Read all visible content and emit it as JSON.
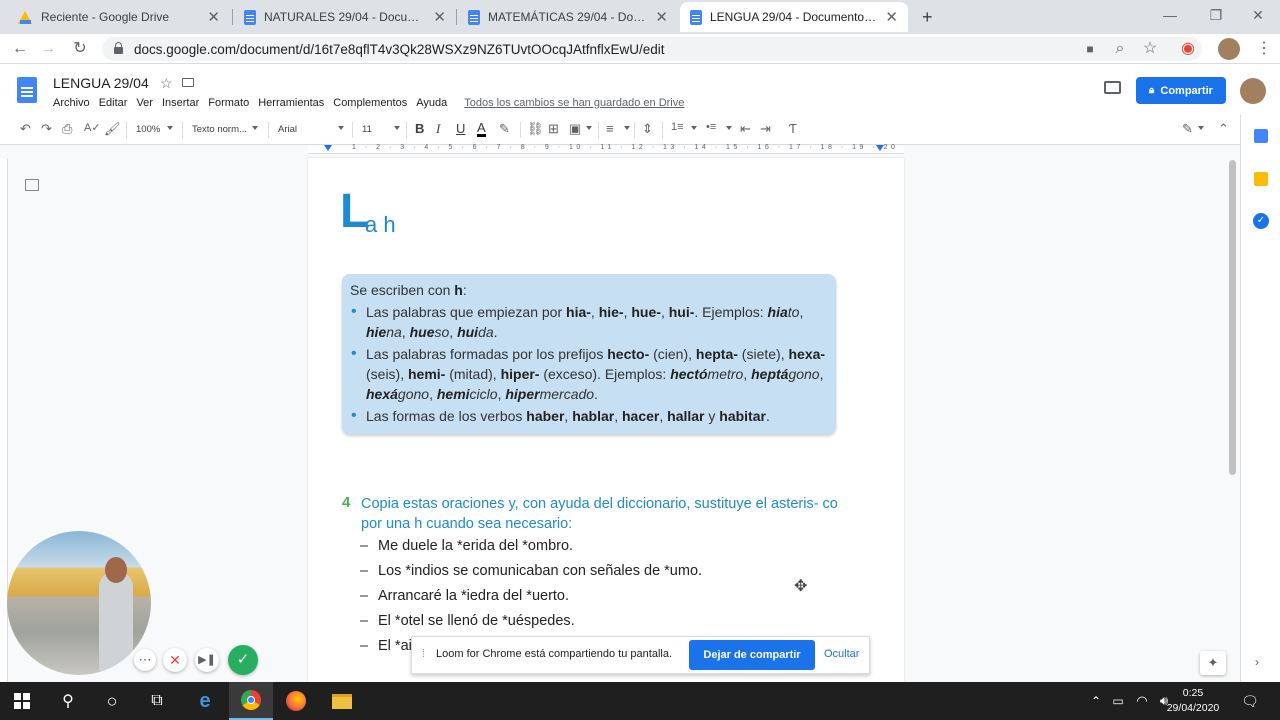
{
  "tabs": [
    {
      "title": "Reciente - Google Drive",
      "icon": "drive-icon"
    },
    {
      "title": "NATURALES 29/04 - Documentos de Google",
      "icon": "docs-icon"
    },
    {
      "title": "MATEMÁTICAS 29/04 - Documentos de Google",
      "icon": "docs-icon"
    },
    {
      "title": "LENGUA 29/04 - Documentos de Google",
      "icon": "docs-icon"
    }
  ],
  "address": {
    "url": "docs.google.com/document/d/16t7e8qflT4v3Qk28WSXz9NZ6TUvtOOcqJAtfnflxEwU/edit"
  },
  "docs": {
    "title": "LENGUA 29/04",
    "menu": [
      "Archivo",
      "Editar",
      "Ver",
      "Insertar",
      "Formato",
      "Herramientas",
      "Complementos",
      "Ayuda"
    ],
    "save_status": "Todos los cambios se han guardado en Drive",
    "share_label": "Compartir"
  },
  "toolbar": {
    "zoom": "100%",
    "style": "Texto norm...",
    "font": "Arial",
    "size": "11"
  },
  "ruler": {
    "numbers": "1 · 2 · 3 · 4 · 5 · 6 · 7 · 8 · 9 · 10 · 11 · 12 · 13 · 14 · 15 · 16 · 17 · 18 · 19 · 20"
  },
  "page": {
    "heading_big": "L",
    "heading_rest": "a h",
    "rule": {
      "intro_a": "Se escriben con ",
      "intro_b": "h",
      ", ": "",
      "item1": "Las palabras que empiezan por hia-, hie-, hue-, hui-. Ejemplos: hiato, hiena, hueso, huida.",
      "item2": "Las palabras formadas por los prefijos hecto- (cien), hepta- (siete), hexa- (seis), hemi- (mitad), hiper- (exceso). Ejemplos: hectómetro, heptágono, hexágono, hemiciclo, hipermercado.",
      "item3": "Las formas de los verbos haber, hablar, hacer, hallar y habitar."
    },
    "exercise": {
      "number": "4",
      "instruction": "Copia estas oraciones y, con ayuda del diccionario, sustituye el asteris- co por una h cuando sea necesario:",
      "dash": "–",
      "sentences": [
        "Me duele la *erida del *ombro.",
        "Los *indios se comunicaban con señales de *umo.",
        "Arrancaré la *iedra del *uerto.",
        "El *otel se llenó de *uéspedes.",
        "El *ai"
      ]
    }
  },
  "loom": {
    "message": "Loom for Chrome está compartiendo tu pantalla.",
    "stop_label": "Dejar de compartir",
    "hide_label": "Ocultar"
  },
  "clock": {
    "time": "0:25",
    "date": "29/04/2020"
  }
}
